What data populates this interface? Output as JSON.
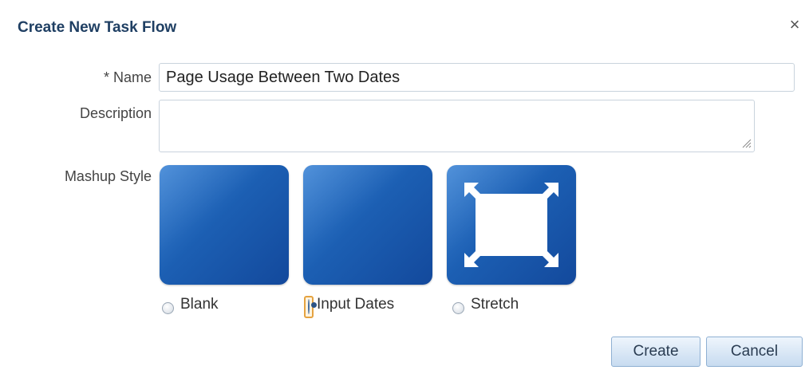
{
  "dialog": {
    "title": "Create New Task Flow",
    "close_symbol": "×"
  },
  "form": {
    "name_label": "* Name",
    "name_value": "Page Usage Between Two Dates",
    "description_label": "Description",
    "description_value": "",
    "mashup_style_label": "Mashup Style"
  },
  "mashup_styles": [
    {
      "label": "Blank",
      "icon": "blank-tile-icon",
      "selected": false
    },
    {
      "label": "Input Dates",
      "icon": "blank-tile-icon",
      "selected": true
    },
    {
      "label": "Stretch",
      "icon": "stretch-arrows-icon",
      "selected": false
    }
  ],
  "buttons": {
    "create": "Create",
    "cancel": "Cancel"
  },
  "colors": {
    "title": "#1f3f63",
    "tile_top": "#3f86d6",
    "tile_bottom": "#13499c",
    "focus": "#e5a341"
  }
}
